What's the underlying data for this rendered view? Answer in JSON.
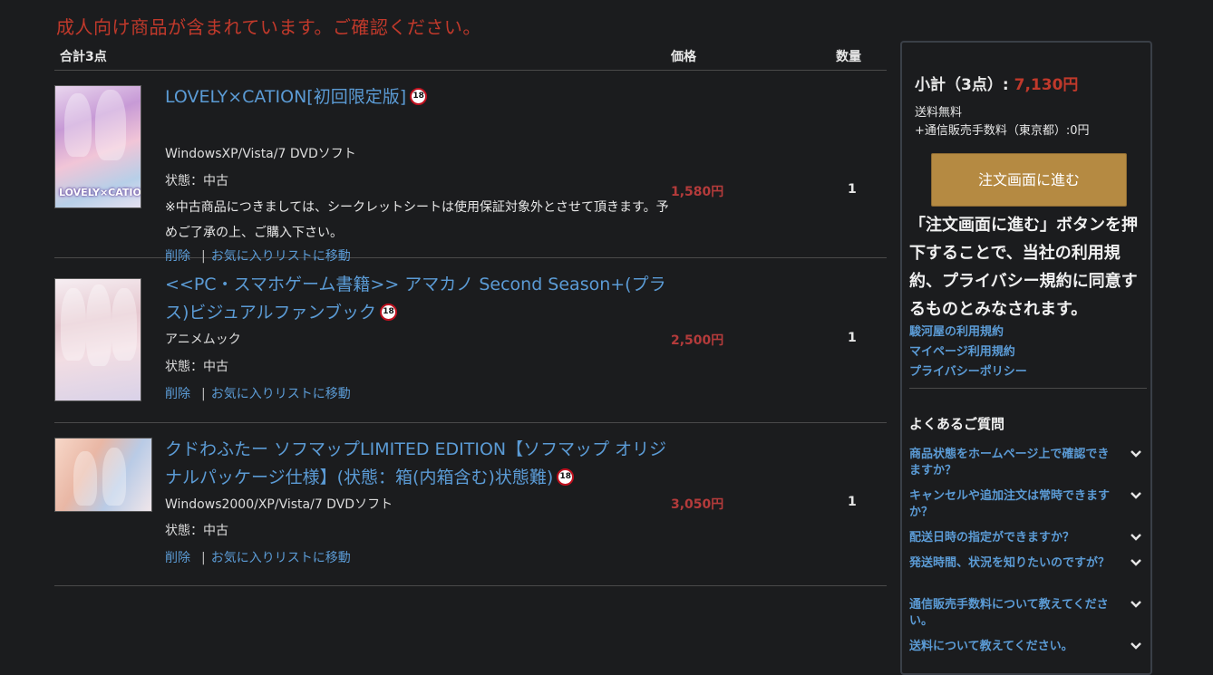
{
  "warning": "成人向け商品が含まれています。ご確認ください。",
  "cart": {
    "total_label": "合計3点",
    "price_header": "価格",
    "qty_header": "数量",
    "items": [
      {
        "title": "LOVELY×CATION[初回限定版]",
        "badge": "18",
        "thumb_logo": "LOVELY×CATION",
        "platform": "WindowsXP/Vista/7  DVDソフト",
        "condition": "状態：中古",
        "note": "※中古商品につきましては、シークレットシートは使用保証対象外とさせて頂きます。予めご了承の上、ご購入下さい。",
        "price": "1,580円",
        "qty": "1",
        "delete": "削除",
        "favorite": "お気に入りリストに移動"
      },
      {
        "title": "<<PC・スマホゲーム書籍>> アマカノ Second Season+(プラス)ビジュアルファンブック",
        "badge": "18",
        "platform": "アニメムック",
        "condition": "状態：中古",
        "price": "2,500円",
        "qty": "1",
        "delete": "削除",
        "favorite": "お気に入りリストに移動"
      },
      {
        "title": "クドわふたー ソフマップLIMITED EDITION【ソフマップ オリジナルパッケージ仕様】(状態：箱(内箱含む)状態難)",
        "badge": "18",
        "platform": "Windows2000/XP/Vista/7  DVDソフト",
        "condition": "状態：中古",
        "price": "3,050円",
        "qty": "1",
        "delete": "削除",
        "favorite": "お気に入りリストに移動"
      }
    ]
  },
  "sidebar": {
    "subtotal_label": "小計（3点）:",
    "subtotal_amount": "7,130円",
    "shipping": "送料無料",
    "fee": "+通信販売手数料（東京都）:0円",
    "order_button": "注文画面に進む",
    "agreement": "「注文画面に進む」ボタンを押下することで、当社の利用規約、プライバシー規約に同意するものとみなされます。",
    "policies": [
      "駿河屋の利用規約",
      "マイページ利用規約",
      "プライバシーポリシー"
    ],
    "faq_title": "よくあるご質問",
    "faq": [
      "商品状態をホームページ上で確認できますか？",
      "キャンセルや追加注文は常時できますか？",
      "配送日時の指定ができますか？",
      "発送時間、状況を知りたいのですが？",
      "通信販売手数料について教えてください。",
      "送料について教えてください。"
    ]
  },
  "colors": {
    "background": "#1b1c1e",
    "warning_red": "#c0392b",
    "link_blue": "#5b9bd5",
    "button_gold": "#b58a42"
  }
}
